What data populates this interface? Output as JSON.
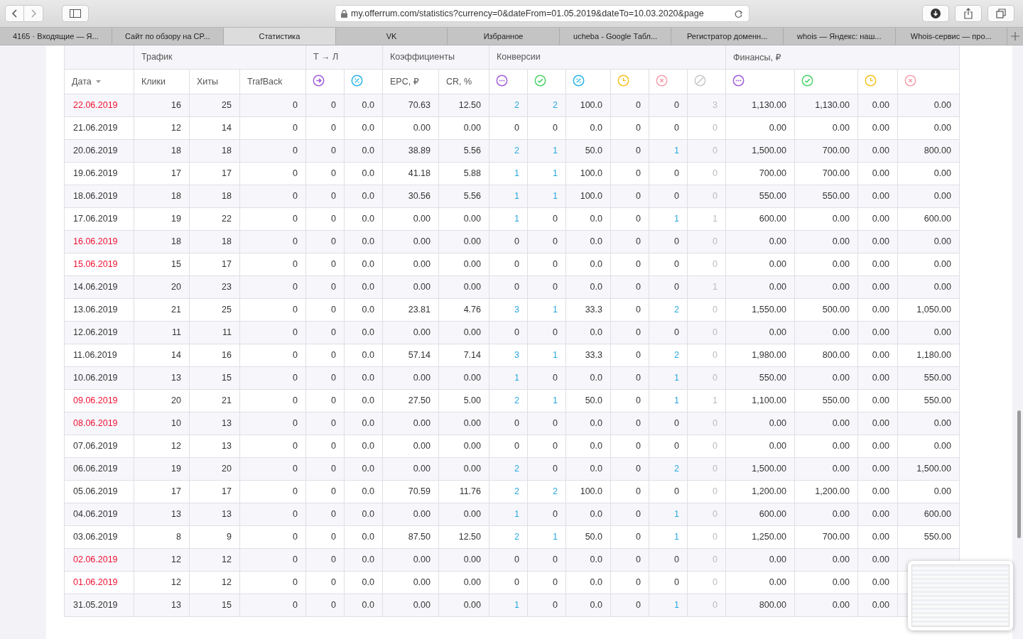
{
  "browser": {
    "url": "my.offerrum.com/statistics?currency=0&dateFrom=01.05.2019&dateTo=10.03.2020&page",
    "tabs": [
      {
        "label": "4165 · Входящие — Я...",
        "selected": false
      },
      {
        "label": "Сайт по обзору на CP...",
        "selected": false
      },
      {
        "label": "Статистика",
        "selected": true
      },
      {
        "label": "VK",
        "selected": false
      },
      {
        "label": "Избранное",
        "selected": false
      },
      {
        "label": "ucheba - Google Табл...",
        "selected": false
      },
      {
        "label": "Регистратор доменн...",
        "selected": false
      },
      {
        "label": "whois — Яндекс: наш...",
        "selected": false
      },
      {
        "label": "Whois-сервис — про...",
        "selected": false
      }
    ]
  },
  "table": {
    "groups": [
      {
        "label": "Трафик"
      },
      {
        "label": "Т → Л"
      },
      {
        "label": "Коэффициенты"
      },
      {
        "label": "Конверсии"
      },
      {
        "label": "Финансы, ₽"
      }
    ],
    "columns": [
      {
        "label": "Дата",
        "kind": "date",
        "sortable": true
      },
      {
        "label": "Клики",
        "kind": "num"
      },
      {
        "label": "Хиты",
        "kind": "num"
      },
      {
        "label": "TrafBack",
        "kind": "num"
      },
      {
        "kind": "num"
      },
      {
        "kind": "num"
      },
      {
        "label": "EPC, ₽",
        "kind": "num"
      },
      {
        "label": "CR, %",
        "kind": "num"
      },
      {
        "kind": "link"
      },
      {
        "kind": "link"
      },
      {
        "kind": "num"
      },
      {
        "kind": "num"
      },
      {
        "kind": "link"
      },
      {
        "kind": "muted"
      },
      {
        "kind": "num"
      },
      {
        "kind": "num"
      },
      {
        "kind": "num"
      },
      {
        "kind": "num"
      }
    ],
    "rows": [
      {
        "weekend": true,
        "cells": [
          "22.06.2019",
          "16",
          "25",
          "0",
          "0",
          "0.0",
          "70.63",
          "12.50",
          "2",
          "2",
          "100.0",
          "0",
          "0",
          "3",
          "1,130.00",
          "1,130.00",
          "0.00",
          "0.00"
        ]
      },
      {
        "weekend": false,
        "cells": [
          "21.06.2019",
          "12",
          "14",
          "0",
          "0",
          "0.0",
          "0.00",
          "0.00",
          "0",
          "0",
          "0.0",
          "0",
          "0",
          "0",
          "0.00",
          "0.00",
          "0.00",
          "0.00"
        ]
      },
      {
        "weekend": false,
        "cells": [
          "20.06.2019",
          "18",
          "18",
          "0",
          "0",
          "0.0",
          "38.89",
          "5.56",
          "2",
          "1",
          "50.0",
          "0",
          "1",
          "0",
          "1,500.00",
          "700.00",
          "0.00",
          "800.00"
        ]
      },
      {
        "weekend": false,
        "cells": [
          "19.06.2019",
          "17",
          "17",
          "0",
          "0",
          "0.0",
          "41.18",
          "5.88",
          "1",
          "1",
          "100.0",
          "0",
          "0",
          "0",
          "700.00",
          "700.00",
          "0.00",
          "0.00"
        ]
      },
      {
        "weekend": false,
        "cells": [
          "18.06.2019",
          "18",
          "18",
          "0",
          "0",
          "0.0",
          "30.56",
          "5.56",
          "1",
          "1",
          "100.0",
          "0",
          "0",
          "0",
          "550.00",
          "550.00",
          "0.00",
          "0.00"
        ]
      },
      {
        "weekend": false,
        "cells": [
          "17.06.2019",
          "19",
          "22",
          "0",
          "0",
          "0.0",
          "0.00",
          "0.00",
          "1",
          "0",
          "0.0",
          "0",
          "1",
          "1",
          "600.00",
          "0.00",
          "0.00",
          "600.00"
        ]
      },
      {
        "weekend": true,
        "cells": [
          "16.06.2019",
          "18",
          "18",
          "0",
          "0",
          "0.0",
          "0.00",
          "0.00",
          "0",
          "0",
          "0.0",
          "0",
          "0",
          "0",
          "0.00",
          "0.00",
          "0.00",
          "0.00"
        ]
      },
      {
        "weekend": true,
        "cells": [
          "15.06.2019",
          "15",
          "17",
          "0",
          "0",
          "0.0",
          "0.00",
          "0.00",
          "0",
          "0",
          "0.0",
          "0",
          "0",
          "0",
          "0.00",
          "0.00",
          "0.00",
          "0.00"
        ]
      },
      {
        "weekend": false,
        "cells": [
          "14.06.2019",
          "20",
          "23",
          "0",
          "0",
          "0.0",
          "0.00",
          "0.00",
          "0",
          "0",
          "0.0",
          "0",
          "0",
          "1",
          "0.00",
          "0.00",
          "0.00",
          "0.00"
        ]
      },
      {
        "weekend": false,
        "cells": [
          "13.06.2019",
          "21",
          "25",
          "0",
          "0",
          "0.0",
          "23.81",
          "4.76",
          "3",
          "1",
          "33.3",
          "0",
          "2",
          "0",
          "1,550.00",
          "500.00",
          "0.00",
          "1,050.00"
        ]
      },
      {
        "weekend": false,
        "cells": [
          "12.06.2019",
          "11",
          "11",
          "0",
          "0",
          "0.0",
          "0.00",
          "0.00",
          "0",
          "0",
          "0.0",
          "0",
          "0",
          "0",
          "0.00",
          "0.00",
          "0.00",
          "0.00"
        ]
      },
      {
        "weekend": false,
        "cells": [
          "11.06.2019",
          "14",
          "16",
          "0",
          "0",
          "0.0",
          "57.14",
          "7.14",
          "3",
          "1",
          "33.3",
          "0",
          "2",
          "0",
          "1,980.00",
          "800.00",
          "0.00",
          "1,180.00"
        ]
      },
      {
        "weekend": false,
        "cells": [
          "10.06.2019",
          "13",
          "15",
          "0",
          "0",
          "0.0",
          "0.00",
          "0.00",
          "1",
          "0",
          "0.0",
          "0",
          "1",
          "0",
          "550.00",
          "0.00",
          "0.00",
          "550.00"
        ]
      },
      {
        "weekend": true,
        "cells": [
          "09.06.2019",
          "20",
          "21",
          "0",
          "0",
          "0.0",
          "27.50",
          "5.00",
          "2",
          "1",
          "50.0",
          "0",
          "1",
          "1",
          "1,100.00",
          "550.00",
          "0.00",
          "550.00"
        ]
      },
      {
        "weekend": true,
        "cells": [
          "08.06.2019",
          "10",
          "13",
          "0",
          "0",
          "0.0",
          "0.00",
          "0.00",
          "0",
          "0",
          "0.0",
          "0",
          "0",
          "0",
          "0.00",
          "0.00",
          "0.00",
          "0.00"
        ]
      },
      {
        "weekend": false,
        "cells": [
          "07.06.2019",
          "12",
          "13",
          "0",
          "0",
          "0.0",
          "0.00",
          "0.00",
          "0",
          "0",
          "0.0",
          "0",
          "0",
          "0",
          "0.00",
          "0.00",
          "0.00",
          "0.00"
        ]
      },
      {
        "weekend": false,
        "cells": [
          "06.06.2019",
          "19",
          "20",
          "0",
          "0",
          "0.0",
          "0.00",
          "0.00",
          "2",
          "0",
          "0.0",
          "0",
          "2",
          "0",
          "1,500.00",
          "0.00",
          "0.00",
          "1,500.00"
        ]
      },
      {
        "weekend": false,
        "cells": [
          "05.06.2019",
          "17",
          "17",
          "0",
          "0",
          "0.0",
          "70.59",
          "11.76",
          "2",
          "2",
          "100.0",
          "0",
          "0",
          "0",
          "1,200.00",
          "1,200.00",
          "0.00",
          "0.00"
        ]
      },
      {
        "weekend": false,
        "cells": [
          "04.06.2019",
          "13",
          "13",
          "0",
          "0",
          "0.0",
          "0.00",
          "0.00",
          "1",
          "0",
          "0.0",
          "0",
          "1",
          "0",
          "600.00",
          "0.00",
          "0.00",
          "600.00"
        ]
      },
      {
        "weekend": false,
        "cells": [
          "03.06.2019",
          "8",
          "9",
          "0",
          "0",
          "0.0",
          "87.50",
          "12.50",
          "2",
          "1",
          "50.0",
          "0",
          "1",
          "0",
          "1,250.00",
          "700.00",
          "0.00",
          "550.00"
        ]
      },
      {
        "weekend": true,
        "cells": [
          "02.06.2019",
          "12",
          "12",
          "0",
          "0",
          "0.0",
          "0.00",
          "0.00",
          "0",
          "0",
          "0.0",
          "0",
          "0",
          "0",
          "0.00",
          "0.00",
          "0.00"
        ]
      },
      {
        "weekend": true,
        "cells": [
          "01.06.2019",
          "12",
          "12",
          "0",
          "0",
          "0.0",
          "0.00",
          "0.00",
          "0",
          "0",
          "0.0",
          "0",
          "0",
          "0",
          "0.00",
          "0.00",
          "0.00"
        ]
      },
      {
        "weekend": false,
        "cells": [
          "31.05.2019",
          "13",
          "15",
          "0",
          "0",
          "0.0",
          "0.00",
          "0.00",
          "1",
          "0",
          "0.0",
          "0",
          "1",
          "0",
          "800.00",
          "0.00",
          "0.00"
        ]
      }
    ]
  }
}
